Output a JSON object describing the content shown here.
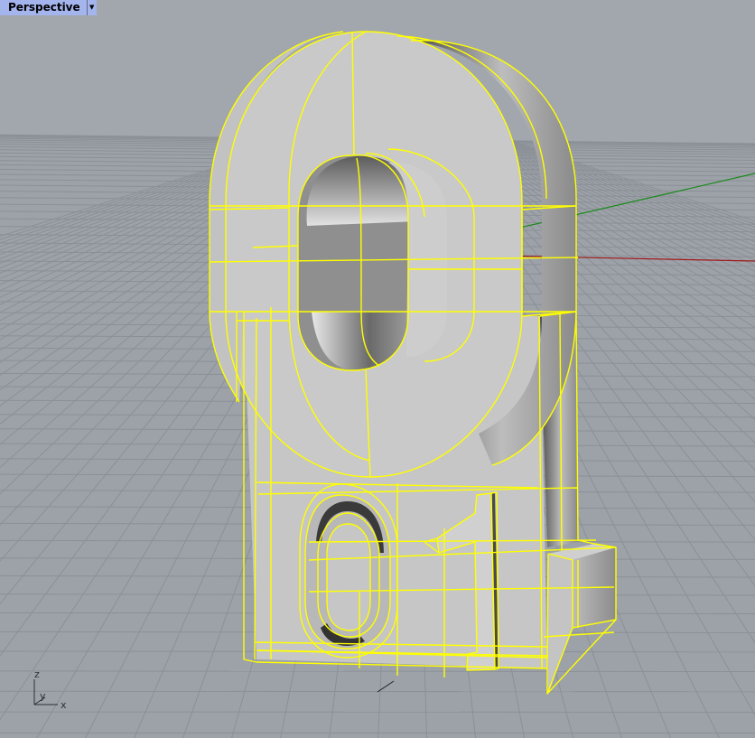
{
  "viewport": {
    "title": "Perspective",
    "menu_icon": "chevron-down-icon"
  },
  "axis_gizmo": {
    "z_label": "z",
    "y_label": "y",
    "x_label": "x"
  },
  "colors": {
    "background_sky": "#a2a7ae",
    "grid_plane": "#9da2a9",
    "grid_line": "#8c9198",
    "selection_wire": "#ffff00",
    "x_axis": "#a01818",
    "y_axis": "#1a8a1a",
    "z_axis": "#1a3ec0",
    "surface_light": "#c9c9c9",
    "surface_dark": "#555555",
    "tab_bg": "#a4b4ec"
  }
}
